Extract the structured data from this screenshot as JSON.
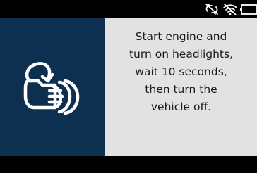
{
  "status_bar": {
    "icons": [
      "no-connection-icon",
      "wifi-off-icon",
      "battery-icon"
    ]
  },
  "main": {
    "illustration_icon": "headlight-icon",
    "instruction": "Start engine and\nturn on headlights,\nwait 10 seconds,\nthen turn the\nvehicle off."
  },
  "colors": {
    "background": "#000000",
    "icon_panel": "#0e3050",
    "text_panel": "#e2e2e2",
    "text": "#1a1a1a",
    "status_icon": "#ffffff"
  }
}
